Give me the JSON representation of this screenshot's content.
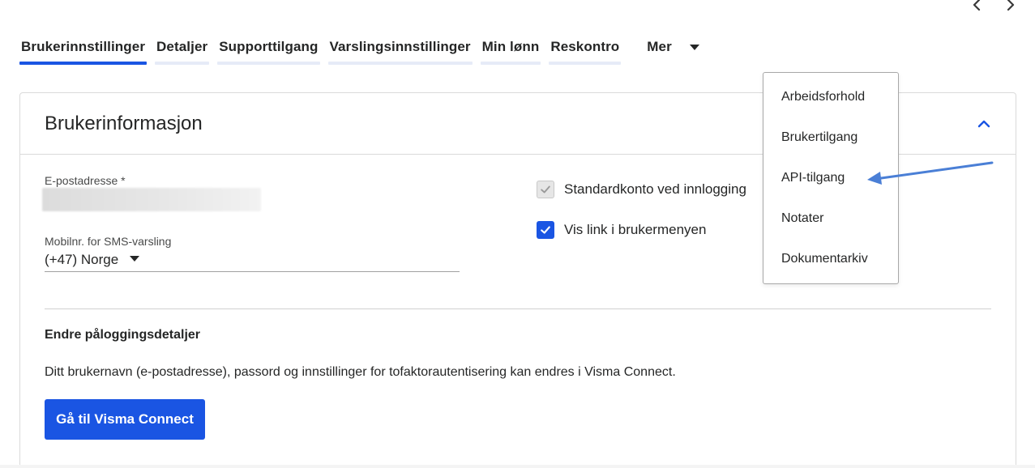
{
  "tabs": [
    {
      "label": "Brukerinnstillinger",
      "active": true
    },
    {
      "label": "Detaljer",
      "active": false
    },
    {
      "label": "Supporttilgang",
      "active": false
    },
    {
      "label": "Varslingsinnstillinger",
      "active": false
    },
    {
      "label": "Min lønn",
      "active": false
    },
    {
      "label": "Reskontro",
      "active": false
    }
  ],
  "more_tab": {
    "label": "Mer"
  },
  "dropdown": {
    "items": [
      "Arbeidsforhold",
      "Brukertilgang",
      "API-tilgang",
      "Notater",
      "Dokumentarkiv"
    ]
  },
  "card": {
    "title": "Brukerinformasjon",
    "email_label": "E-postadresse *",
    "phone_label": "Mobilnr. for SMS-varsling",
    "phone_value": "(+47) Norge",
    "checkbox_default_account": "Standardkonto ved innlogging",
    "checkbox_show_link": "Vis link i brukermenyen",
    "section_title": "Endre påloggingsdetaljer",
    "section_text": "Ditt brukernavn (e-postadresse), passord og innstillinger for tofaktorautentisering kan endres i Visma Connect.",
    "button_label": "Gå til Visma Connect"
  },
  "colors": {
    "accent": "#1a55e3",
    "annotation_arrow": "#4a7fd6"
  },
  "icons": [
    "chevron-left-icon",
    "chevron-right-icon",
    "chevron-up-icon",
    "caret-down-icon",
    "checkmark-icon"
  ]
}
